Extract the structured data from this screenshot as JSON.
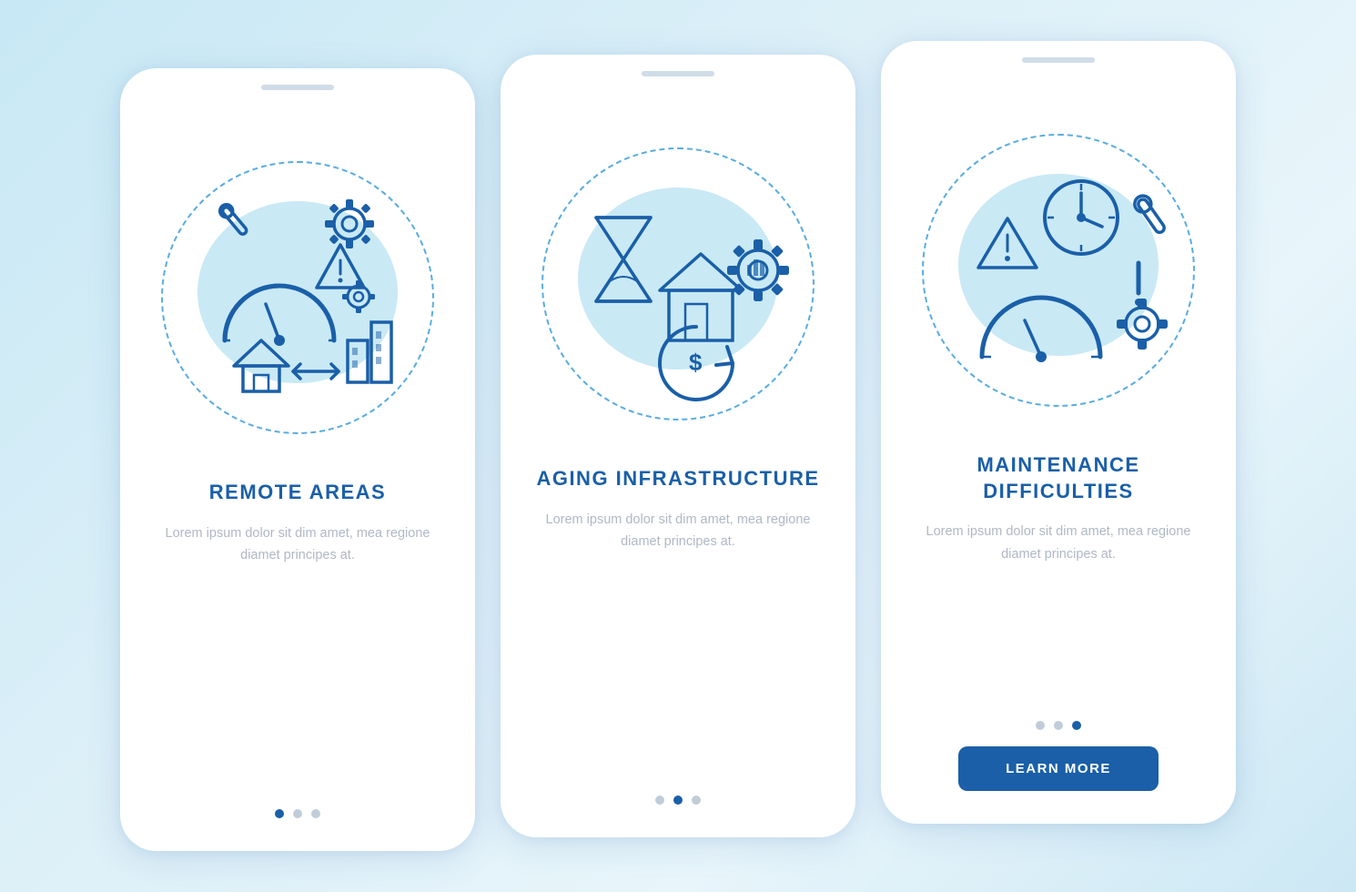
{
  "cards": [
    {
      "id": "remote-areas",
      "title": "REMOTE\nAREAS",
      "body": "Lorem ipsum dolor sit dim amet, mea regione diamet principes at.",
      "dots": [
        "active",
        "inactive",
        "inactive"
      ],
      "has_button": false,
      "button_label": ""
    },
    {
      "id": "aging-infrastructure",
      "title": "AGING\nINFRASTRUCTURE",
      "body": "Lorem ipsum dolor sit dim amet, mea regione diamet principes at.",
      "dots": [
        "inactive",
        "active",
        "inactive"
      ],
      "has_button": false,
      "button_label": ""
    },
    {
      "id": "maintenance-difficulties",
      "title": "MAINTENANCE\nDIFFICULTIES",
      "body": "Lorem ipsum dolor sit dim amet, mea regione diamet principes at.",
      "dots": [
        "inactive",
        "inactive",
        "active"
      ],
      "has_button": true,
      "button_label": "LEARN MORE"
    }
  ],
  "accent_color": "#1a5fa8",
  "light_blue": "#c9e9f5",
  "icon_color": "#1a5fa8"
}
